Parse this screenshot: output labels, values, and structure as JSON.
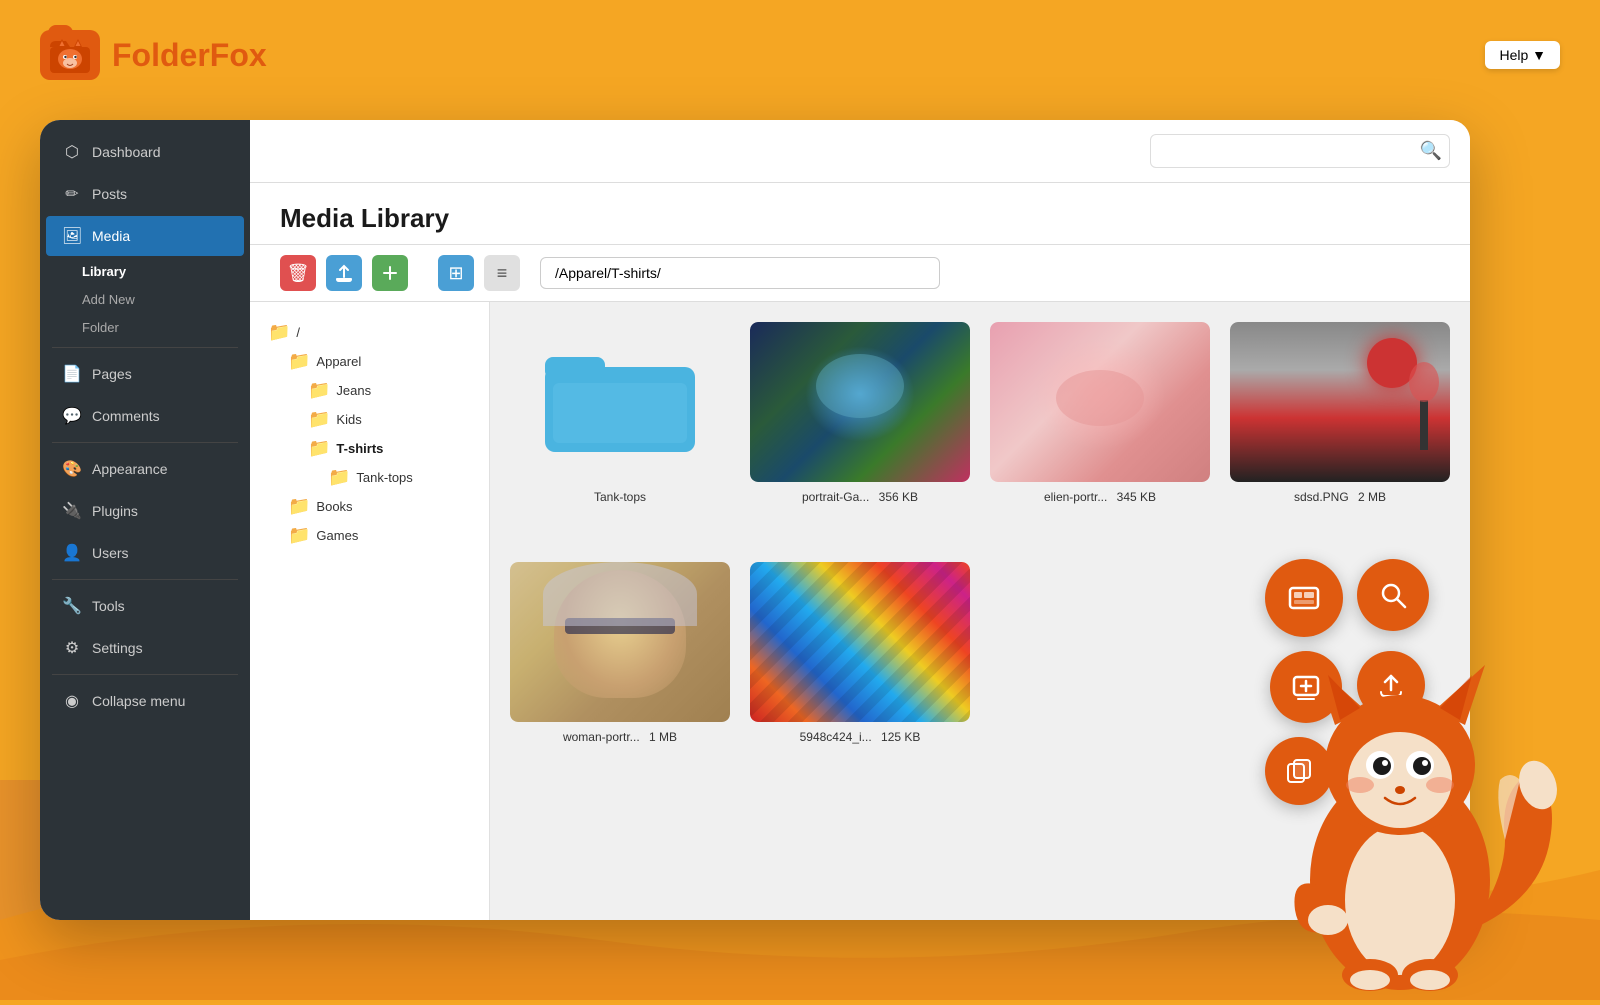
{
  "app": {
    "name_prefix": "Folder",
    "name_suffix": "Fox",
    "logo_emoji": "🦊"
  },
  "help_button": {
    "label": "Help ▼"
  },
  "search": {
    "placeholder": ""
  },
  "page": {
    "title": "Media Library"
  },
  "toolbar": {
    "delete_label": "🗑",
    "upload_label": "☁",
    "add_label": "+",
    "grid_view_label": "⊞",
    "list_view_label": "≡",
    "breadcrumb_value": "/Apparel/T-shirts/"
  },
  "sidebar": {
    "items": [
      {
        "id": "dashboard",
        "label": "Dashboard",
        "icon": "⬡"
      },
      {
        "id": "posts",
        "label": "Posts",
        "icon": "✏"
      },
      {
        "id": "media",
        "label": "Media",
        "icon": "🖼",
        "active": true
      },
      {
        "id": "pages",
        "label": "Pages",
        "icon": "📄"
      },
      {
        "id": "comments",
        "label": "Comments",
        "icon": "💬"
      },
      {
        "id": "appearance",
        "label": "Appearance",
        "icon": "🎨"
      },
      {
        "id": "plugins",
        "label": "Plugins",
        "icon": "🔌"
      },
      {
        "id": "users",
        "label": "Users",
        "icon": "👤"
      },
      {
        "id": "tools",
        "label": "Tools",
        "icon": "🔧"
      },
      {
        "id": "settings",
        "label": "Settings",
        "icon": "⚙"
      },
      {
        "id": "collapse",
        "label": "Collapse menu",
        "icon": "◉"
      }
    ],
    "media_sub": [
      {
        "id": "library",
        "label": "Library",
        "active": true
      },
      {
        "id": "add-new",
        "label": "Add New"
      },
      {
        "id": "folder",
        "label": "Folder"
      }
    ]
  },
  "file_tree": {
    "root": "/",
    "items": [
      {
        "label": "Apparel",
        "icon": "blue",
        "children": [
          {
            "label": "Jeans",
            "icon": "light"
          },
          {
            "label": "Kids",
            "icon": "light"
          },
          {
            "label": "T-shirts",
            "icon": "blue",
            "active": true,
            "children": [
              {
                "label": "Tank-tops",
                "icon": "light"
              }
            ]
          },
          {
            "label": "Books",
            "icon": "light"
          },
          {
            "label": "Games",
            "icon": "light"
          }
        ]
      }
    ]
  },
  "media_items": [
    {
      "id": "tank-tops-folder",
      "name": "Tank-tops",
      "type": "folder",
      "size": ""
    },
    {
      "id": "portrait-ga",
      "name": "portrait-Ga...",
      "type": "image",
      "size": "356 KB",
      "style": "portrait1"
    },
    {
      "id": "elien-port",
      "name": "elien-portr...",
      "type": "image",
      "size": "345 KB",
      "style": "portrait2"
    },
    {
      "id": "sdsd-png",
      "name": "sdsd.PNG",
      "type": "image",
      "size": "2 MB",
      "style": "painting"
    },
    {
      "id": "woman-portr",
      "name": "woman-portr...",
      "type": "image",
      "size": "1 MB",
      "style": "woman"
    },
    {
      "id": "5948c424",
      "name": "5948c424_i...",
      "type": "image",
      "size": "125 KB",
      "style": "abstract"
    }
  ],
  "action_buttons": [
    {
      "id": "gallery",
      "icon": "🖼",
      "label": "gallery"
    },
    {
      "id": "search",
      "icon": "🔍",
      "label": "search"
    },
    {
      "id": "add-media",
      "icon": "➕",
      "label": "add-media"
    },
    {
      "id": "upload",
      "icon": "☁",
      "label": "upload"
    },
    {
      "id": "copy",
      "icon": "📋",
      "label": "copy"
    }
  ],
  "colors": {
    "orange_primary": "#E05A10",
    "orange_bg": "#F5A623",
    "sidebar_bg": "#2c3338",
    "active_blue": "#2271b1",
    "folder_blue": "#4ab4e0"
  }
}
